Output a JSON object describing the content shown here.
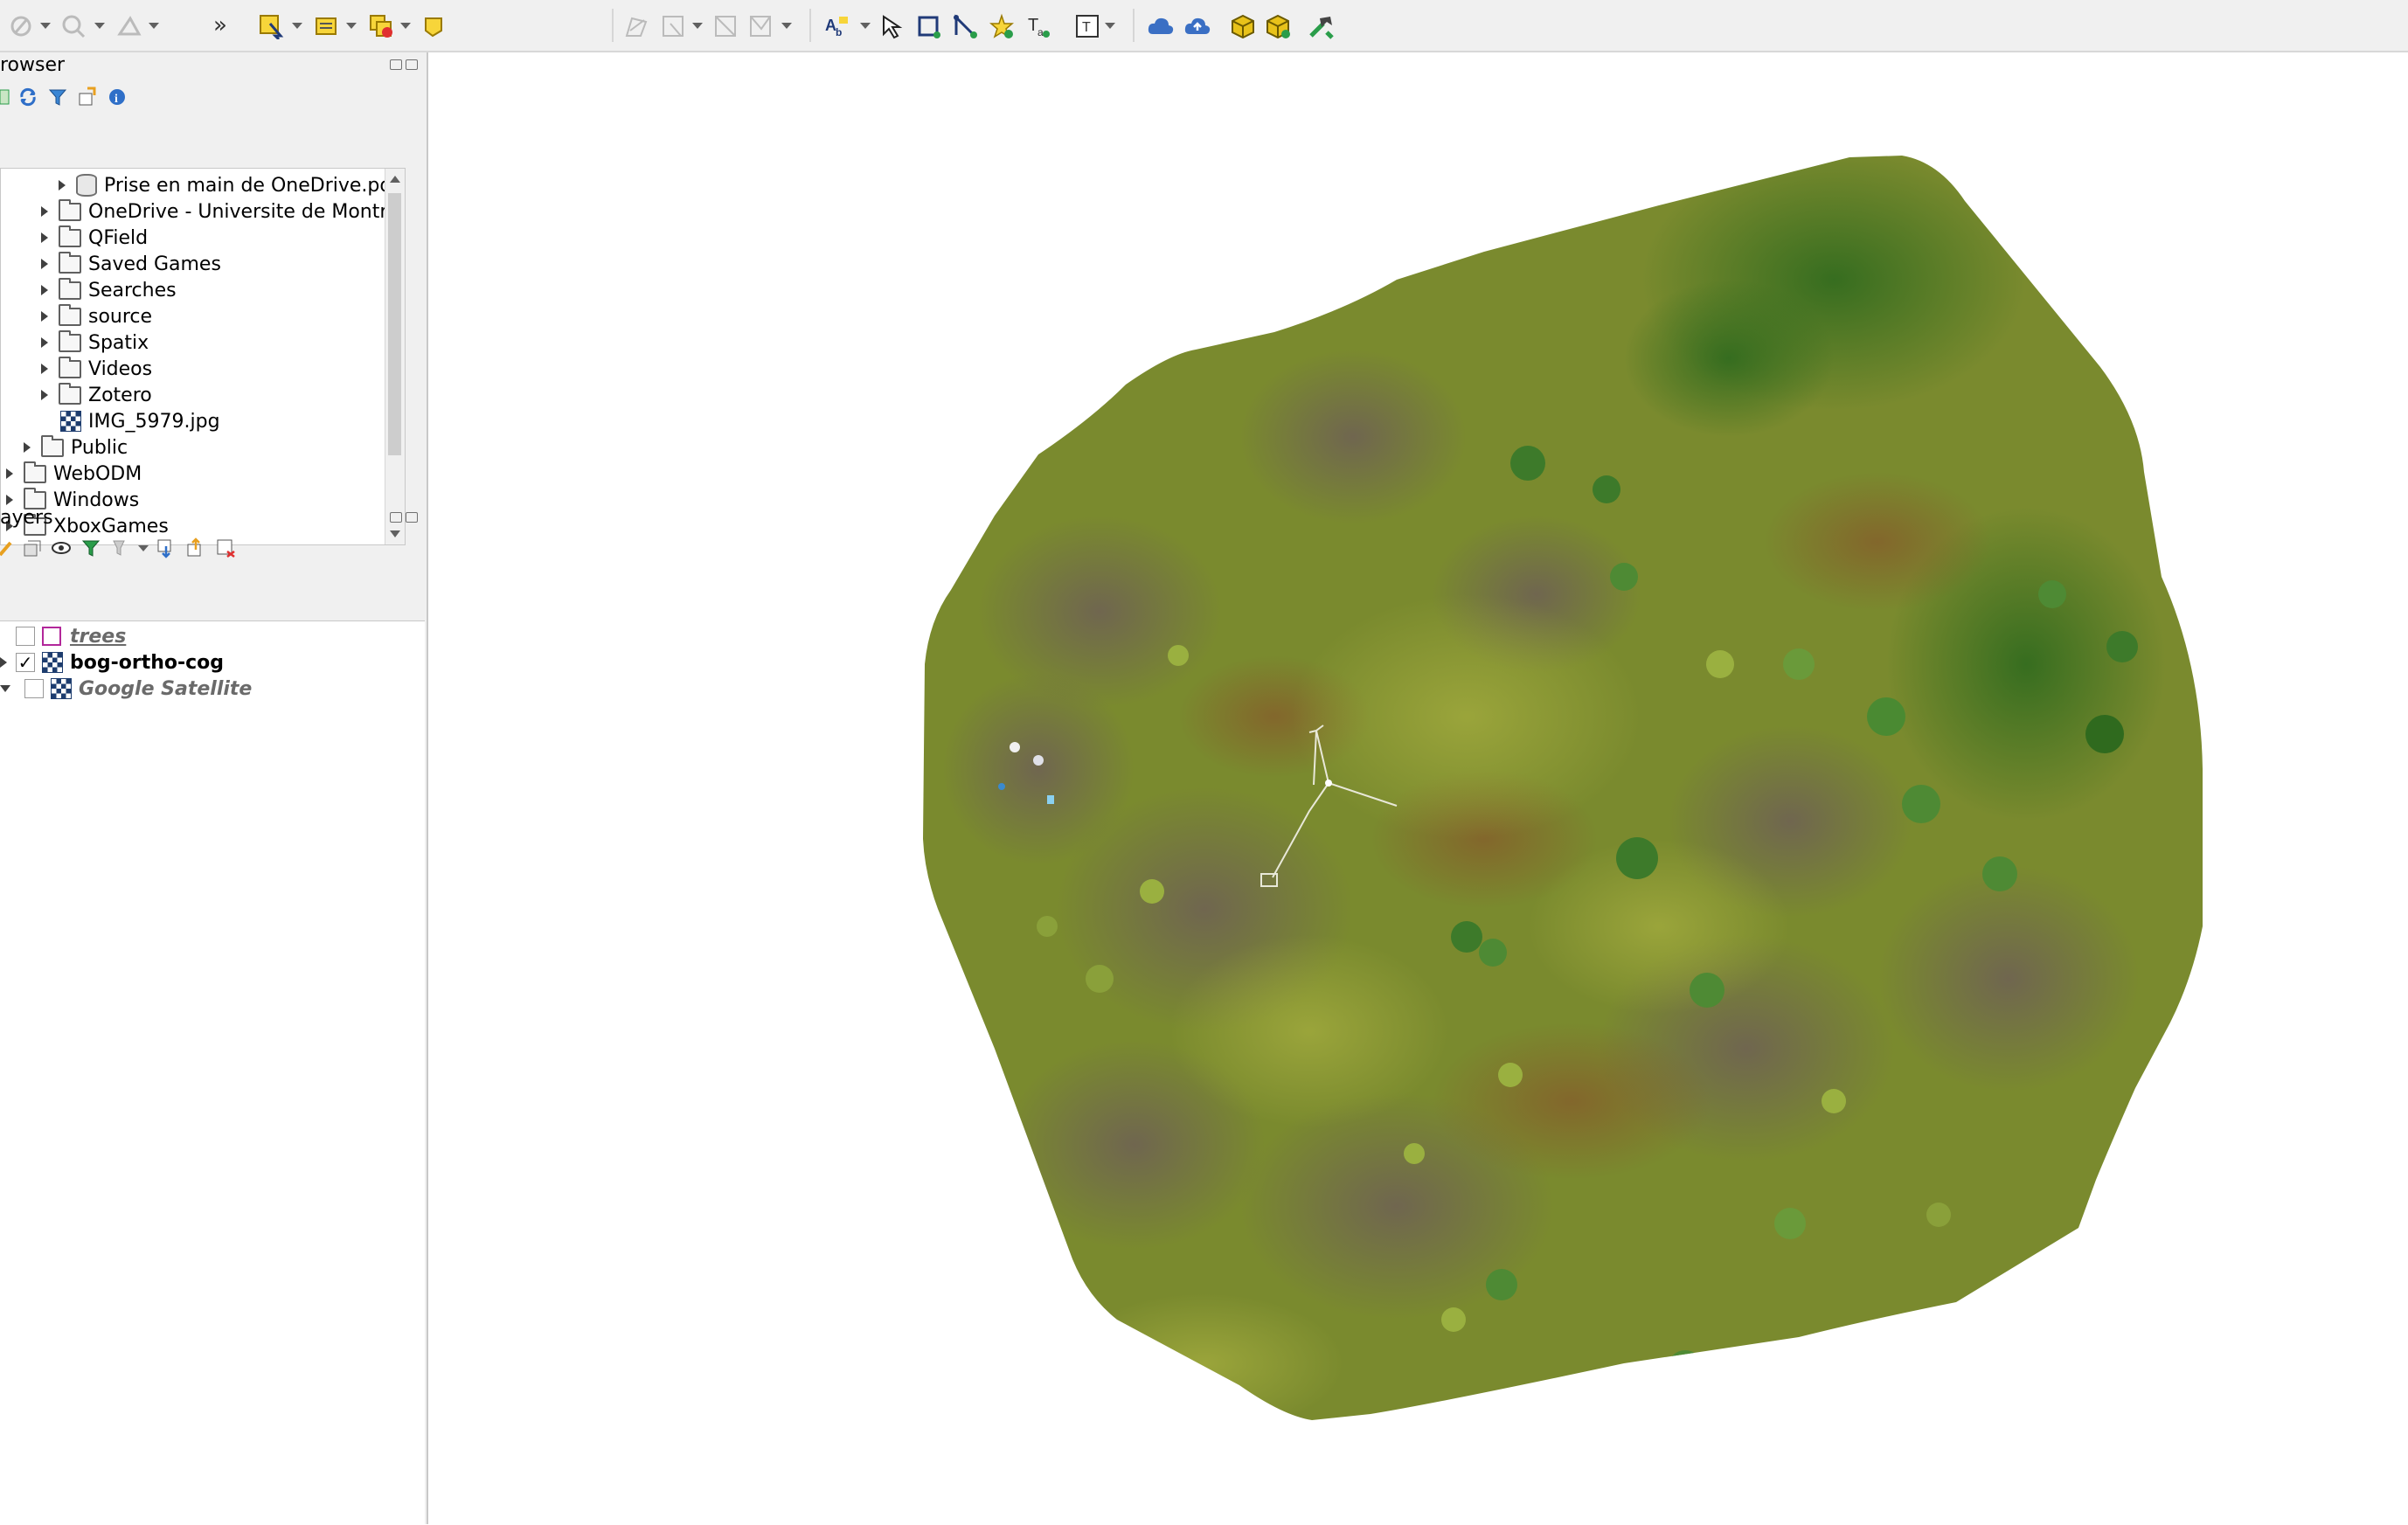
{
  "toolbar": {
    "overflow_label": "»"
  },
  "browser_panel": {
    "title": "rowser",
    "items": [
      {
        "label": "Prise en main de OneDrive.pdf",
        "icon": "database-icon"
      },
      {
        "label": "OneDrive - Universite de Montreal",
        "icon": "folder-icon"
      },
      {
        "label": "QField",
        "icon": "folder-icon"
      },
      {
        "label": "Saved Games",
        "icon": "folder-icon"
      },
      {
        "label": "Searches",
        "icon": "folder-icon"
      },
      {
        "label": "source",
        "icon": "folder-icon"
      },
      {
        "label": "Spatix",
        "icon": "folder-icon"
      },
      {
        "label": "Videos",
        "icon": "folder-icon"
      },
      {
        "label": "Zotero",
        "icon": "folder-icon"
      },
      {
        "label": "IMG_5979.jpg",
        "icon": "raster-icon"
      },
      {
        "label": "Public",
        "icon": "folder-icon"
      },
      {
        "label": "WebODM",
        "icon": "folder-icon"
      },
      {
        "label": "Windows",
        "icon": "folder-icon"
      },
      {
        "label": "XboxGames",
        "icon": "folder-icon"
      }
    ]
  },
  "layers_panel": {
    "title": "ayers",
    "layers": [
      {
        "name": "trees",
        "checked": false,
        "icon": "polygon-layer-icon",
        "color": "#b2279a"
      },
      {
        "name": "bog-ortho-cog",
        "checked": true,
        "icon": "raster-layer-icon"
      },
      {
        "name": "Google Satellite",
        "checked": false,
        "icon": "raster-layer-icon"
      }
    ]
  },
  "map": {
    "background": "#ffffff",
    "ortho_base_color": "#7a8a2e"
  }
}
